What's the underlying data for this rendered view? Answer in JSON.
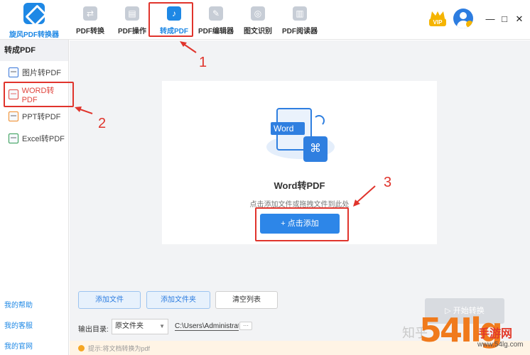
{
  "app": {
    "logo_text": "旋风PDF转换器"
  },
  "nav": [
    {
      "label": "PDF转换",
      "icon": "convert-icon",
      "active": false
    },
    {
      "label": "PDF操作",
      "icon": "document-icon",
      "active": false
    },
    {
      "label": "转成PDF",
      "icon": "pdf-icon",
      "active": true
    },
    {
      "label": "PDF编辑器",
      "icon": "pencil-icon",
      "active": false
    },
    {
      "label": "图文识别",
      "icon": "ocr-icon",
      "active": false
    },
    {
      "label": "PDF阅读器",
      "icon": "reader-icon",
      "active": false
    }
  ],
  "topright": {
    "vip_label": "VIP",
    "minimize": "—",
    "maximize": "□",
    "close": "✕"
  },
  "sidebar": {
    "title": "转成PDF",
    "items": [
      {
        "label": "图片转PDF",
        "icon": "image-icon",
        "active": false
      },
      {
        "label": "WORD转PDF",
        "icon": "word-icon",
        "active": true
      },
      {
        "label": "PPT转PDF",
        "icon": "ppt-icon",
        "active": false
      },
      {
        "label": "Excel转PDF",
        "icon": "excel-icon",
        "active": false
      }
    ],
    "links": [
      "我的帮助",
      "我的客服",
      "我的官网"
    ]
  },
  "main": {
    "illustration_word": "Word",
    "card_title": "Word转PDF",
    "card_hint": "点击添加文件或拖拽文件到此处",
    "add_button": "+ 点击添加"
  },
  "bottom": {
    "add_file": "添加文件",
    "add_folder": "添加文件夹",
    "clear_list": "清空列表",
    "start": "▷ 开始转换",
    "output_label": "输出目录:",
    "output_select": "原文件夹",
    "output_path": "C:\\Users\\Administrator",
    "more": "···",
    "tip": "提示:将文档转换为pdf"
  },
  "annotations": {
    "n1": "1",
    "n2": "2",
    "n3": "3",
    "color": "#e0342c"
  },
  "watermark": {
    "zhi": "知乎",
    "big": "54Ilg",
    "cn": "手游网",
    "url": "www.54lg.com"
  },
  "colors": {
    "accent": "#1e88e5",
    "primary_button": "#2d86e8",
    "annotation": "#e0342c"
  }
}
